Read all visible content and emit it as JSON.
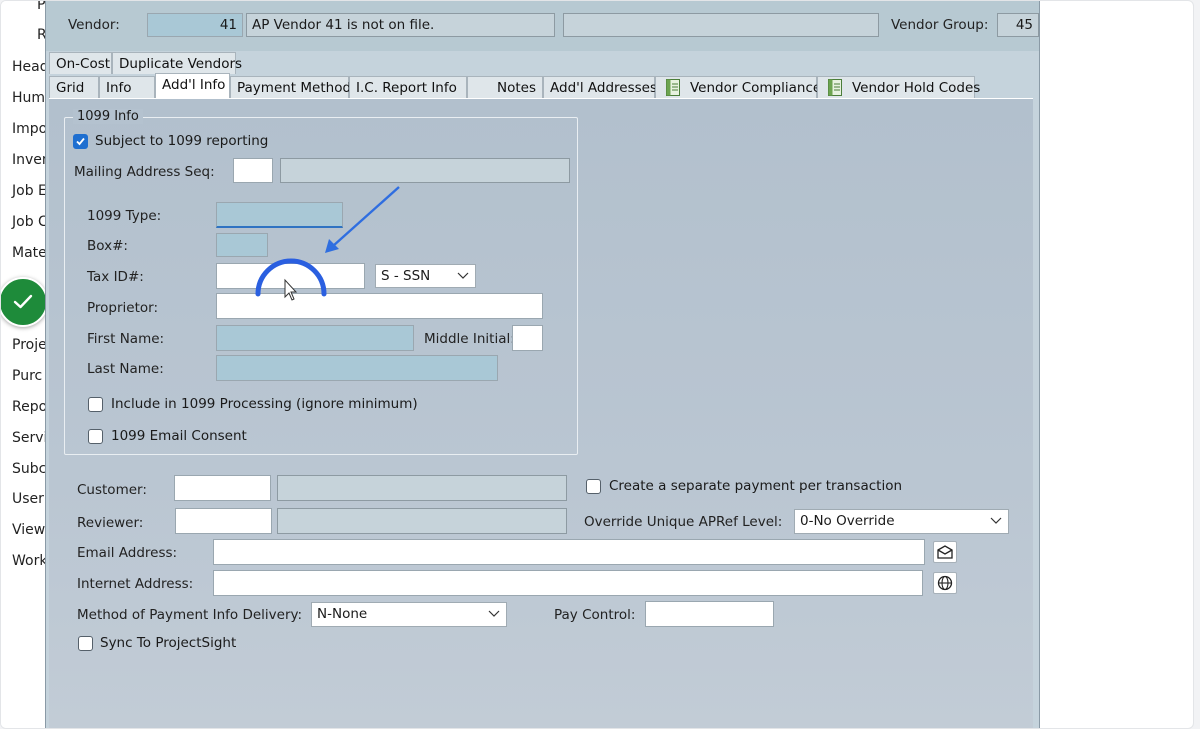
{
  "left_nav": {
    "items": [
      "P",
      "R",
      "Head",
      "Hum",
      "Impo",
      "Inven",
      "Job E",
      "Job C",
      "Mate",
      "Proje",
      "Purc",
      "Repo",
      "Servi",
      "Subc",
      "User",
      "View",
      "Work"
    ]
  },
  "header": {
    "vendor_label": "Vendor:",
    "vendor_value": "41",
    "vendor_desc": "AP Vendor 41 is not on file.",
    "vendor_group_label": "Vendor Group:",
    "vendor_group_value": "45"
  },
  "tabs_top": [
    "On-Cost",
    "Duplicate Vendors"
  ],
  "tabs_main": [
    "Grid",
    "Info",
    "Add'l Info",
    "Payment Method",
    "I.C. Report Info",
    "Notes",
    "Add'l Addresses",
    "Vendor Compliance",
    "Vendor Hold Codes"
  ],
  "info1099": {
    "title": "1099 Info",
    "subject_label": "Subject to 1099 reporting",
    "mailing_label": "Mailing Address Seq:",
    "type_label": "1099 Type:",
    "box_label": "Box#:",
    "taxid_label": "Tax ID#:",
    "taxid_type": "S - SSN",
    "proprietor_label": "Proprietor:",
    "first_name_label": "First Name:",
    "middle_initial_label": "Middle Initial:",
    "last_name_label": "Last Name:",
    "include_label": "Include in 1099 Processing (ignore minimum)",
    "email_consent_label": "1099 Email Consent"
  },
  "lower": {
    "customer_label": "Customer:",
    "reviewer_label": "Reviewer:",
    "separate_payment_label": "Create a separate payment per transaction",
    "override_label": "Override Unique APRef Level:",
    "override_value": "0-No Override",
    "email_label": "Email Address:",
    "internet_label": "Internet Address:",
    "method_label": "Method of Payment Info Delivery:",
    "method_value": "N-None",
    "pay_control_label": "Pay Control:",
    "sync_label": "Sync To ProjectSight"
  }
}
